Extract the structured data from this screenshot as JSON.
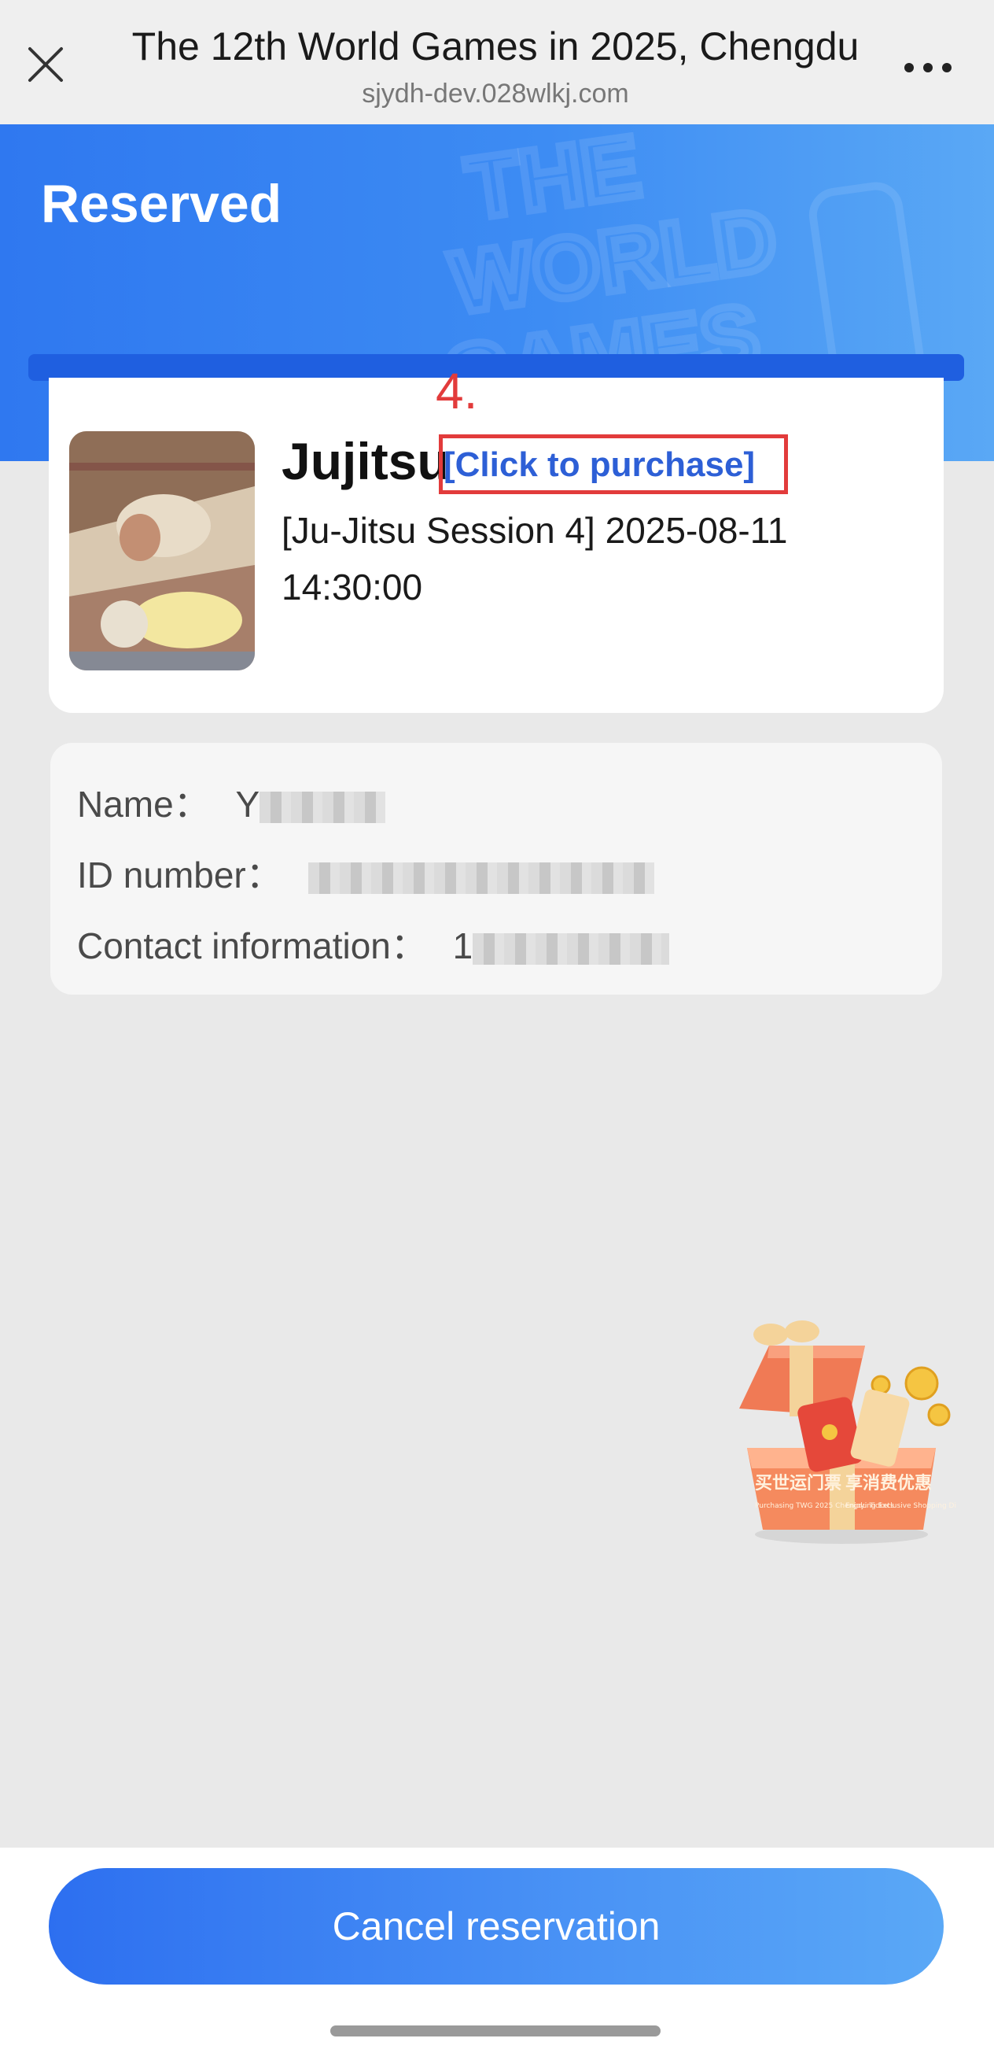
{
  "browser": {
    "title": "The 12th World Games in 2025, Chengdu",
    "url": "sjydh-dev.028wlkj.com",
    "close_icon": "close-icon",
    "more_icon": "more-icon"
  },
  "header": {
    "status": "Reserved",
    "watermark": [
      "THE",
      "WORLD",
      "GAMES"
    ]
  },
  "event": {
    "name": "Jujitsu",
    "purchase_link": "[Click to purchase]",
    "annotation": "4.",
    "session": " [Ju-Jitsu Session 4] 2025-08-11 14:30:00"
  },
  "info": {
    "name_label": "Name：",
    "name_value_visible": "Y",
    "id_label": "ID number：",
    "contact_label": "Contact information：",
    "contact_value_visible": "1"
  },
  "promo": {
    "cn_left": "买世运门票",
    "cn_right": "享消费优惠",
    "en_left": "Purchasing TWG 2025 Chengdu Tickets",
    "en_right": "Enjoying Exclusive Shopping Discounts"
  },
  "footer": {
    "cancel_label": "Cancel reservation"
  },
  "colors": {
    "accent": "#2f78f0",
    "link": "#2d5fd6",
    "annotation": "#e23b3b",
    "background": "#e9e9e9"
  }
}
